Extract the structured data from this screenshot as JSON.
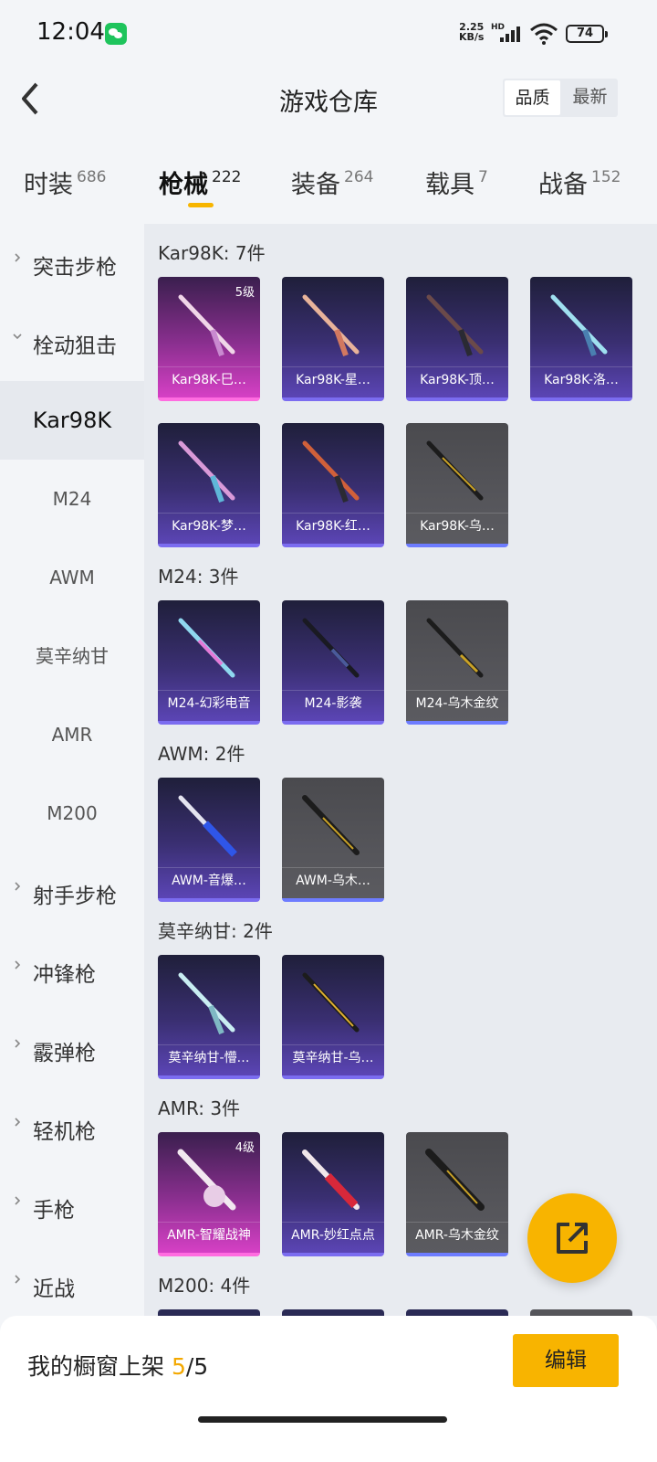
{
  "status_bar": {
    "time": "12:04",
    "net_speed_value": "2.25",
    "net_speed_unit": "KB/s",
    "signal_label": "HD",
    "battery": "74"
  },
  "header": {
    "title": "游戏仓库",
    "sort_options": [
      "品质",
      "最新"
    ],
    "sort_selected": "品质"
  },
  "tabs": [
    {
      "label": "时装",
      "count": "686"
    },
    {
      "label": "枪械",
      "count": "222",
      "active": true
    },
    {
      "label": "装备",
      "count": "264"
    },
    {
      "label": "载具",
      "count": "7"
    },
    {
      "label": "战备",
      "count": "152"
    }
  ],
  "sidebar": {
    "categories": [
      {
        "label": "突击步枪",
        "expanded": false
      },
      {
        "label": "栓动狙击",
        "expanded": true
      },
      {
        "label": "射手步枪",
        "expanded": false
      },
      {
        "label": "冲锋枪",
        "expanded": false
      },
      {
        "label": "霰弹枪",
        "expanded": false
      },
      {
        "label": "轻机枪",
        "expanded": false
      },
      {
        "label": "手枪",
        "expanded": false
      },
      {
        "label": "近战",
        "expanded": false
      }
    ],
    "sub_items": [
      "Kar98K",
      "M24",
      "AWM",
      "莫辛纳甘",
      "AMR",
      "M200"
    ],
    "active_sub": "Kar98K"
  },
  "groups": [
    {
      "title": "Kar98K: 7件",
      "items": [
        {
          "name": "Kar98K-巳…",
          "rarity": "pink",
          "level": "5级"
        },
        {
          "name": "Kar98K-星…",
          "rarity": "purple"
        },
        {
          "name": "Kar98K-顶…",
          "rarity": "purple"
        },
        {
          "name": "Kar98K-洛…",
          "rarity": "purple"
        },
        {
          "name": "Kar98K-梦…",
          "rarity": "purple"
        },
        {
          "name": "Kar98K-红…",
          "rarity": "purple"
        },
        {
          "name": "Kar98K-乌…",
          "rarity": "gray"
        }
      ]
    },
    {
      "title": "M24: 3件",
      "items": [
        {
          "name": "M24-幻彩电音",
          "rarity": "purple"
        },
        {
          "name": "M24-影袭",
          "rarity": "purple"
        },
        {
          "name": "M24-乌木金纹",
          "rarity": "gray"
        }
      ]
    },
    {
      "title": "AWM: 2件",
      "items": [
        {
          "name": "AWM-音爆…",
          "rarity": "purple"
        },
        {
          "name": "AWM-乌木…",
          "rarity": "gray"
        }
      ]
    },
    {
      "title": "莫辛纳甘: 2件",
      "items": [
        {
          "name": "莫辛纳甘-懵…",
          "rarity": "purple"
        },
        {
          "name": "莫辛纳甘-乌…",
          "rarity": "purple"
        }
      ]
    },
    {
      "title": "AMR: 3件",
      "items": [
        {
          "name": "AMR-智耀战神",
          "rarity": "pink",
          "level": "4级"
        },
        {
          "name": "AMR-妙红点点",
          "rarity": "purple"
        },
        {
          "name": "AMR-乌木金纹",
          "rarity": "gray"
        }
      ]
    },
    {
      "title": "M200: 4件",
      "items": []
    }
  ],
  "bottom": {
    "shelf_label": "我的橱窗上架",
    "shelf_current": "5",
    "shelf_total": "/5",
    "edit_label": "编辑"
  }
}
